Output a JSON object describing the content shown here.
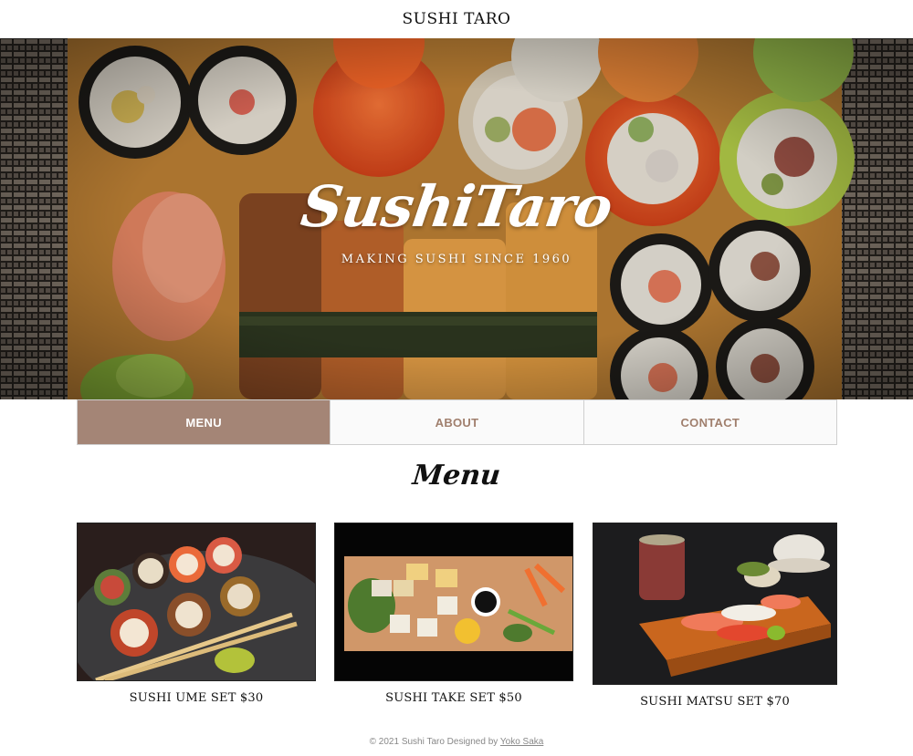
{
  "header": {
    "title": "SUSHI TARO"
  },
  "hero": {
    "logo_text": "SushiTaro",
    "tagline": "MAKING SUSHI SINCE 1960"
  },
  "nav": {
    "items": [
      {
        "label": "MENU",
        "active": true
      },
      {
        "label": "ABOUT",
        "active": false
      },
      {
        "label": "CONTACT",
        "active": false
      }
    ]
  },
  "menu_section": {
    "title": "Menu",
    "cards": [
      {
        "caption": "SUSHI UME SET $30"
      },
      {
        "caption": "SUSHI TAKE SET $50"
      },
      {
        "caption": "SUSHI MATSU SET $70"
      }
    ]
  },
  "footer": {
    "text": "© 2021 Sushi Taro Designed by",
    "link_text": "Yoko Saka"
  },
  "colors": {
    "nav_active": "#a48576",
    "nav_text": "#a07f6d",
    "board": "#c98d3c"
  }
}
